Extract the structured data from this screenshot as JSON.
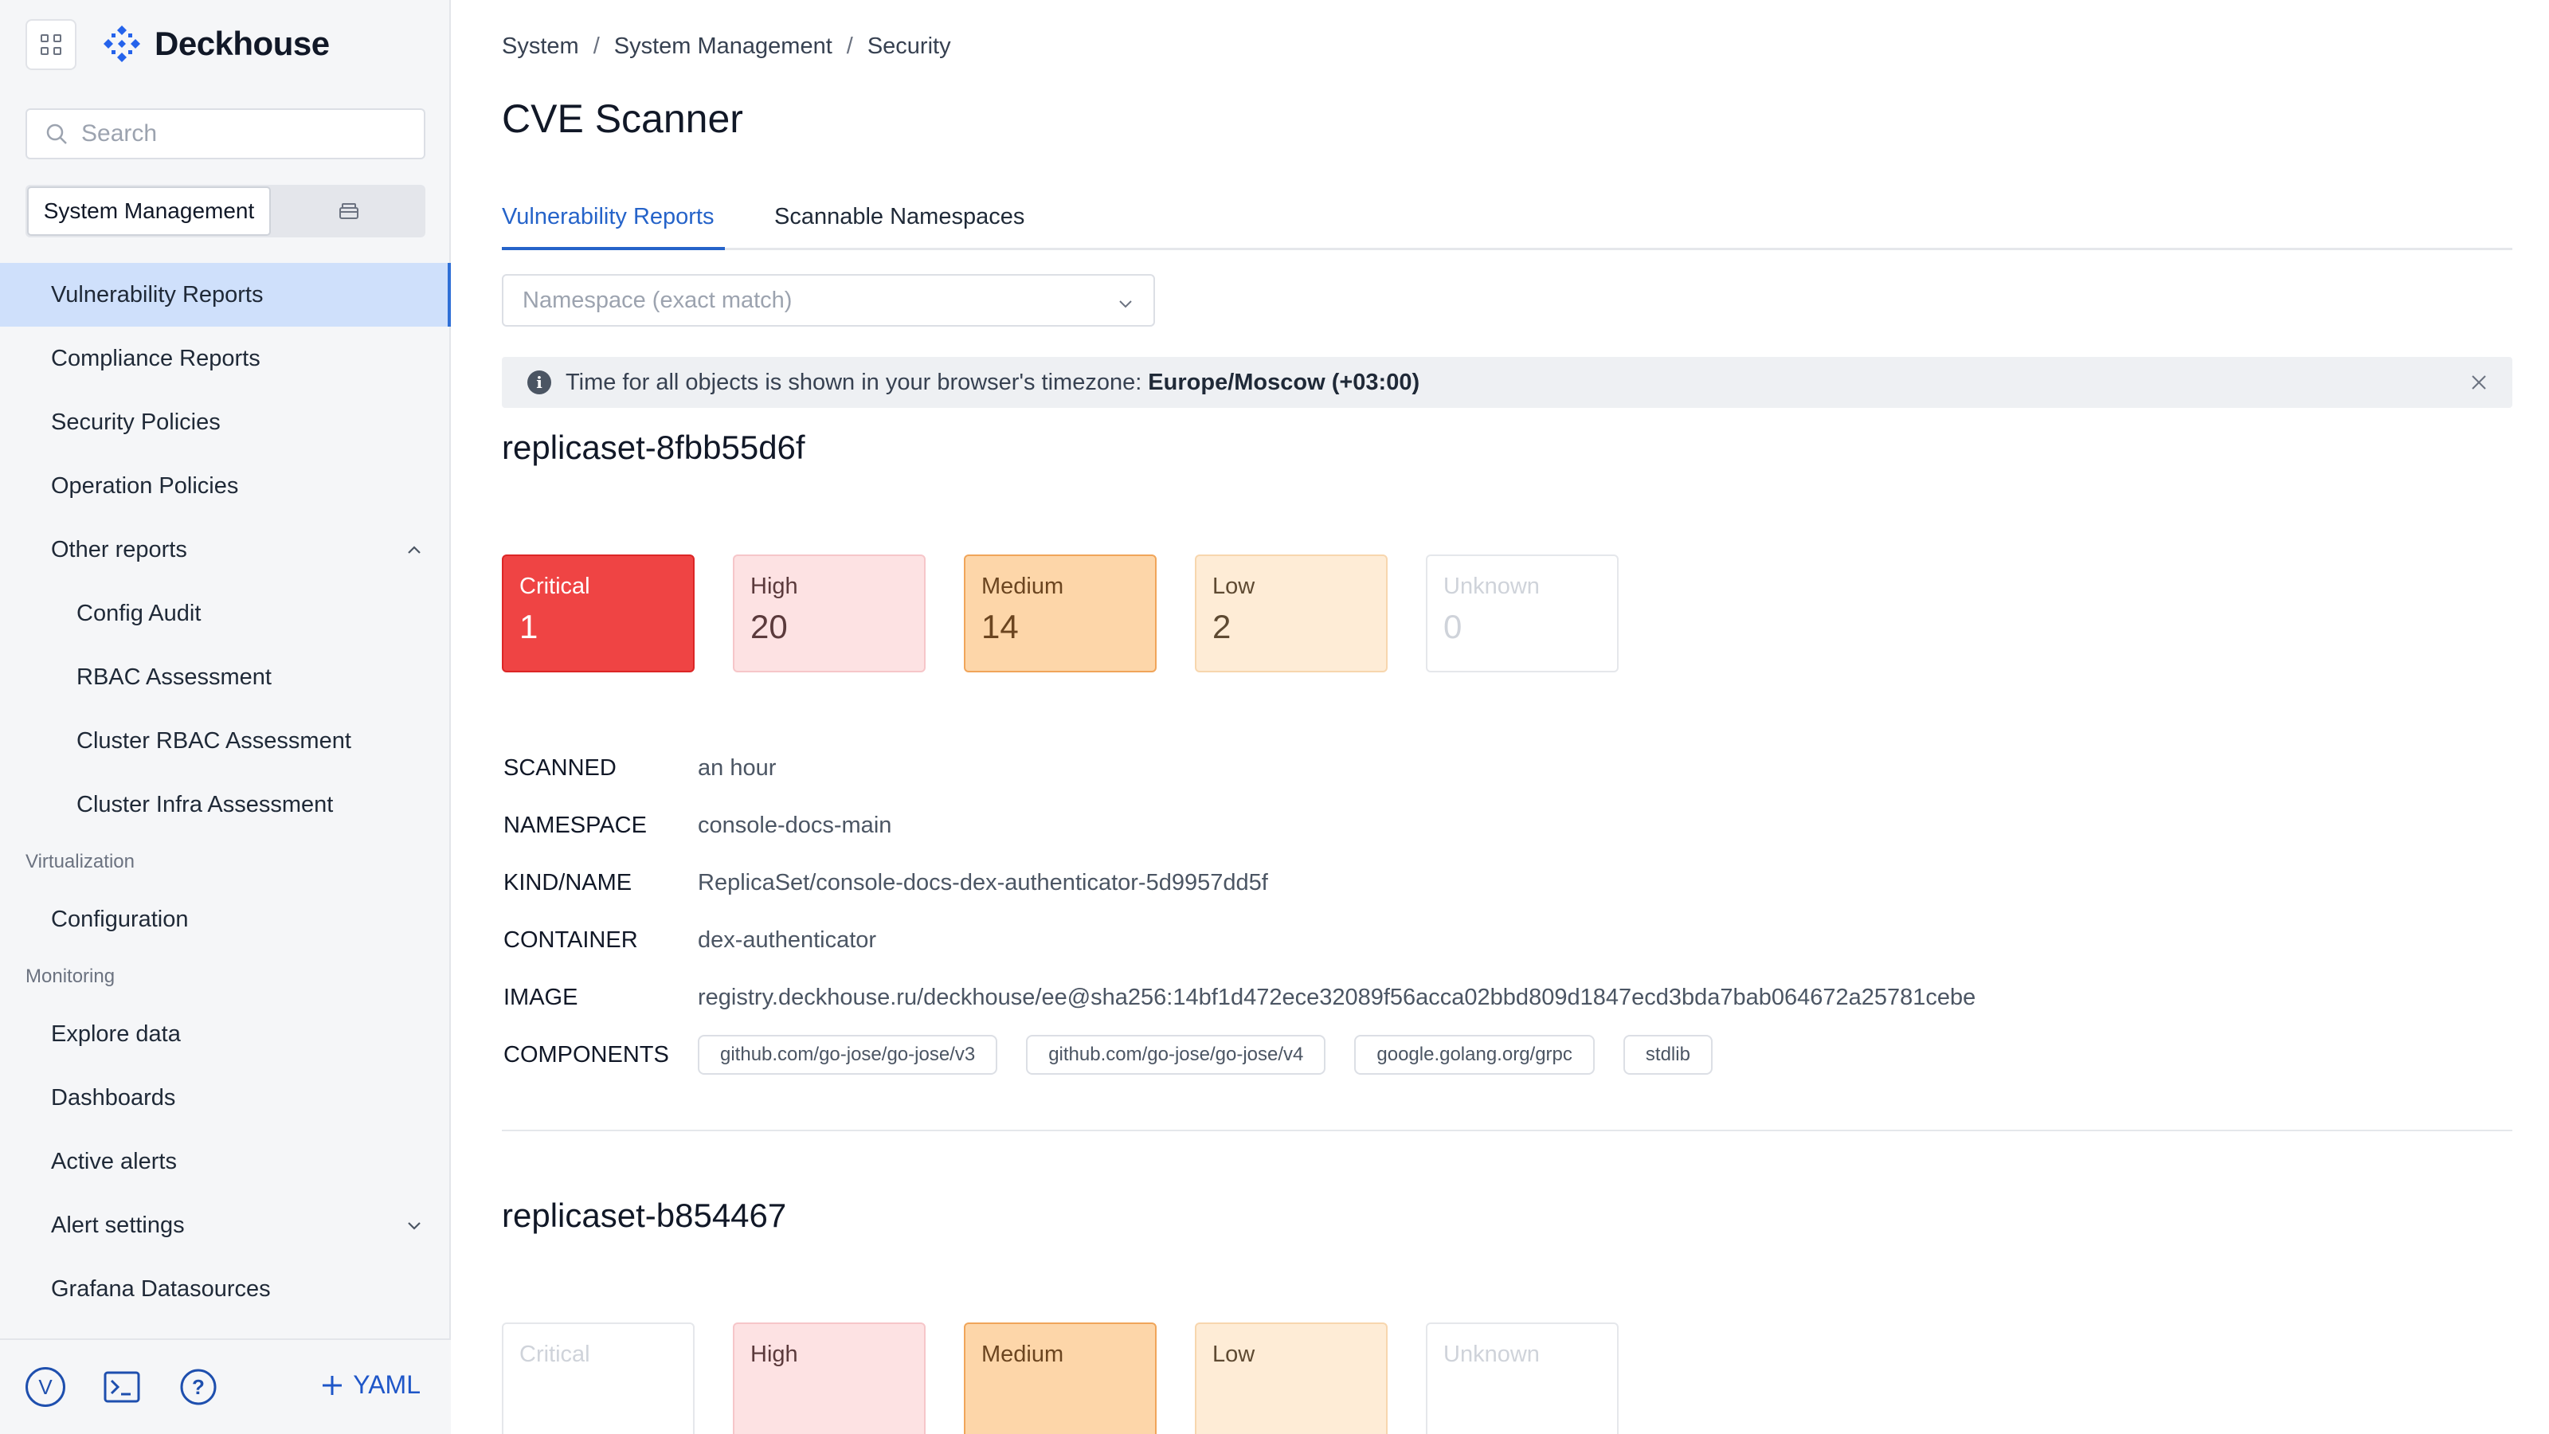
{
  "app": {
    "name": "Deckhouse"
  },
  "search": {
    "placeholder": "Search"
  },
  "context_switch": {
    "active_label": "System Management"
  },
  "sidebar": {
    "items": [
      {
        "label": "Vulnerability Reports",
        "active": true
      },
      {
        "label": "Compliance Reports"
      },
      {
        "label": "Security Policies"
      },
      {
        "label": "Operation Policies"
      },
      {
        "label": "Other reports",
        "expanded": true
      },
      {
        "label": "Config Audit"
      },
      {
        "label": "RBAC Assessment"
      },
      {
        "label": "Cluster RBAC Assessment"
      },
      {
        "label": "Cluster Infra Assessment"
      }
    ],
    "groups": [
      {
        "label": "Virtualization",
        "items": [
          {
            "label": "Configuration"
          }
        ]
      },
      {
        "label": "Monitoring",
        "items": [
          {
            "label": "Explore data"
          },
          {
            "label": "Dashboards"
          },
          {
            "label": "Active alerts"
          },
          {
            "label": "Alert settings"
          },
          {
            "label": "Grafana Datasources"
          }
        ]
      }
    ],
    "footer": {
      "avatar": "V",
      "yaml_label": "YAML"
    }
  },
  "breadcrumb": [
    "System",
    "System Management",
    "Security"
  ],
  "page": {
    "title": "CVE Scanner"
  },
  "tabs": [
    {
      "label": "Vulnerability Reports",
      "active": true
    },
    {
      "label": "Scannable Namespaces"
    }
  ],
  "filter": {
    "namespace_placeholder": "Namespace (exact match)"
  },
  "banner": {
    "text": "Time for all objects is shown in your browser's timezone:",
    "timezone": "Europe/Moscow (+03:00)"
  },
  "reports": [
    {
      "title": "replicaset-8fbb55d6f",
      "counts": {
        "critical": {
          "label": "Critical",
          "value": "1"
        },
        "high": {
          "label": "High",
          "value": "20"
        },
        "medium": {
          "label": "Medium",
          "value": "14"
        },
        "low": {
          "label": "Low",
          "value": "2"
        },
        "unknown": {
          "label": "Unknown",
          "value": "0"
        }
      },
      "meta": {
        "scanned": {
          "key": "SCANNED",
          "value": "an hour"
        },
        "namespace": {
          "key": "NAMESPACE",
          "value": "console-docs-main"
        },
        "kind_name": {
          "key": "KIND/NAME",
          "value": "ReplicaSet/console-docs-dex-authenticator-5d9957dd5f"
        },
        "container": {
          "key": "CONTAINER",
          "value": "dex-authenticator"
        },
        "image": {
          "key": "IMAGE",
          "value": "registry.deckhouse.ru/deckhouse/ee@sha256:14bf1d472ece32089f56acca02bbd809d1847ecd3bda7bab064672a25781cebe"
        },
        "components": {
          "key": "COMPONENTS",
          "values": [
            "github.com/go-jose/go-jose/v3",
            "github.com/go-jose/go-jose/v4",
            "google.golang.org/grpc",
            "stdlib"
          ]
        }
      }
    },
    {
      "title": "replicaset-b854467",
      "counts": {
        "critical": {
          "label": "Critical"
        },
        "high": {
          "label": "High"
        },
        "medium": {
          "label": "Medium"
        },
        "low": {
          "label": "Low"
        },
        "unknown": {
          "label": "Unknown"
        }
      }
    }
  ],
  "colors": {
    "accent": "#2563c9",
    "critical": "#ef4444",
    "high": "#fde2e3",
    "medium": "#fdd6a9",
    "low": "#feecd6",
    "active_nav": "#cfe0fb"
  }
}
